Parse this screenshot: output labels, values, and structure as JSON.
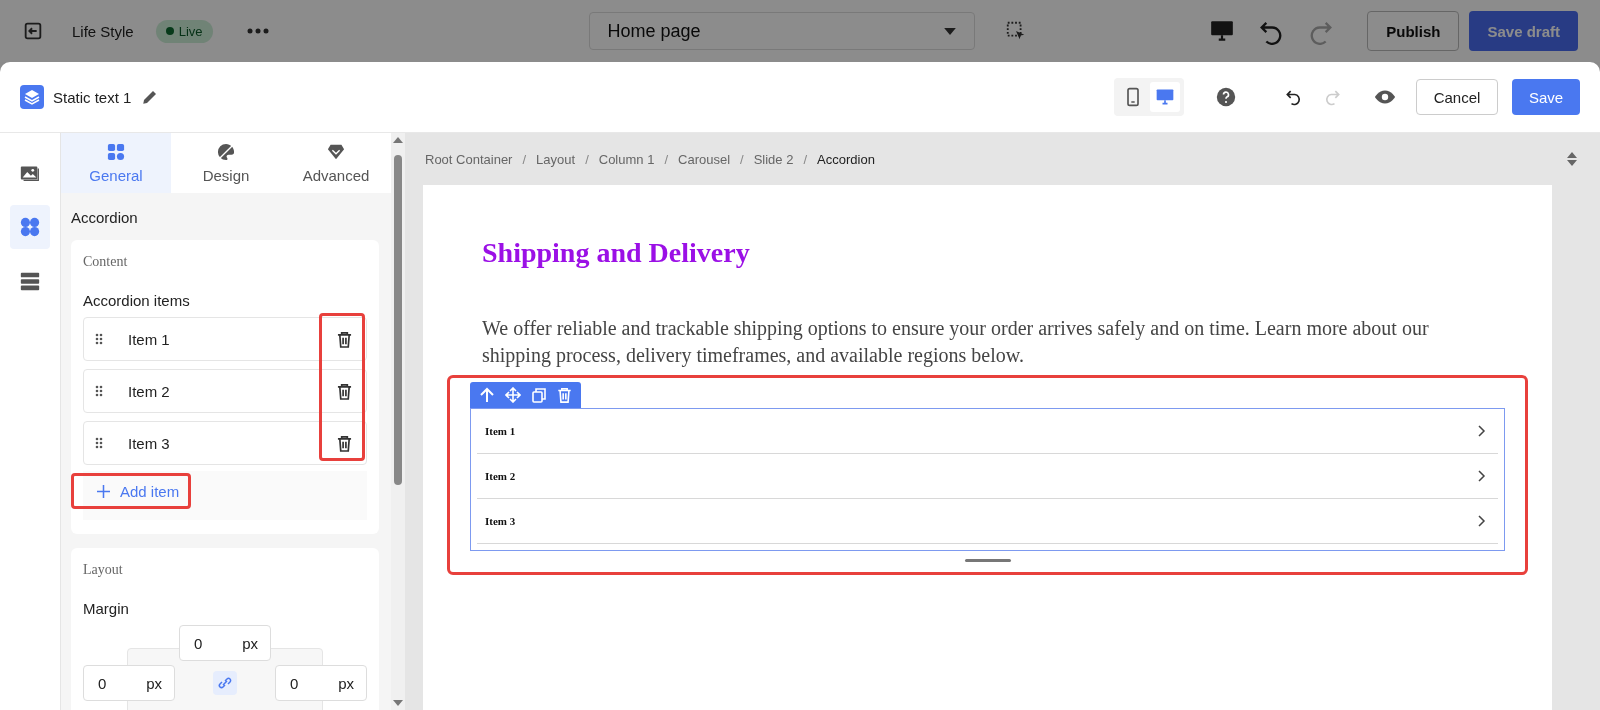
{
  "topbar": {
    "site": "Life Style",
    "status": "Live",
    "page_select": "Home page",
    "history": [
      {
        "kind": "undo",
        "disabled": false
      },
      {
        "kind": "redo",
        "disabled": true
      }
    ],
    "publish": "Publish",
    "save_draft": "Save draft"
  },
  "header": {
    "title": "Static text 1",
    "views": [
      {
        "kind": "mobile",
        "selected": false
      },
      {
        "kind": "desktop",
        "selected": true
      }
    ],
    "history": [
      {
        "kind": "undo",
        "disabled": false
      },
      {
        "kind": "redo",
        "disabled": true
      }
    ],
    "cancel": "Cancel",
    "save": "Save"
  },
  "rail": [
    {
      "kind": "media",
      "selected": false
    },
    {
      "kind": "elements",
      "selected": true
    },
    {
      "kind": "layers",
      "selected": false
    }
  ],
  "tabs": [
    {
      "label": "General",
      "kind": "general",
      "selected": true
    },
    {
      "label": "Design",
      "kind": "design",
      "selected": false
    },
    {
      "label": "Advanced",
      "kind": "advanced",
      "selected": false
    }
  ],
  "panel": {
    "section": "Accordion",
    "content_title": "Content",
    "items_label": "Accordion items",
    "items": [
      "Item 1",
      "Item 2",
      "Item 3"
    ],
    "add_item": "Add item",
    "layout_title": "Layout",
    "margin_label": "Margin",
    "margin": {
      "top": {
        "value": "0",
        "unit": "px"
      },
      "left": {
        "value": "0",
        "unit": "px"
      },
      "right": {
        "value": "0",
        "unit": "px"
      }
    }
  },
  "breadcrumb_separators": [
    "/",
    "/",
    "/",
    "/",
    "/"
  ],
  "breadcrumb": [
    {
      "label": "Root Container",
      "selected": false
    },
    {
      "label": "Layout",
      "selected": false
    },
    {
      "label": "Column 1",
      "selected": false
    },
    {
      "label": "Carousel",
      "selected": false
    },
    {
      "label": "Slide 2",
      "selected": false
    },
    {
      "label": "Accordion",
      "selected": true
    }
  ],
  "canvas": {
    "heading": "Shipping and Delivery",
    "body": "We offer reliable and trackable shipping options to ensure your order arrives safely and on time. Learn more about our shipping process, delivery timeframes, and available regions below.",
    "accordion": [
      "Item 1",
      "Item 2",
      "Item 3"
    ]
  }
}
